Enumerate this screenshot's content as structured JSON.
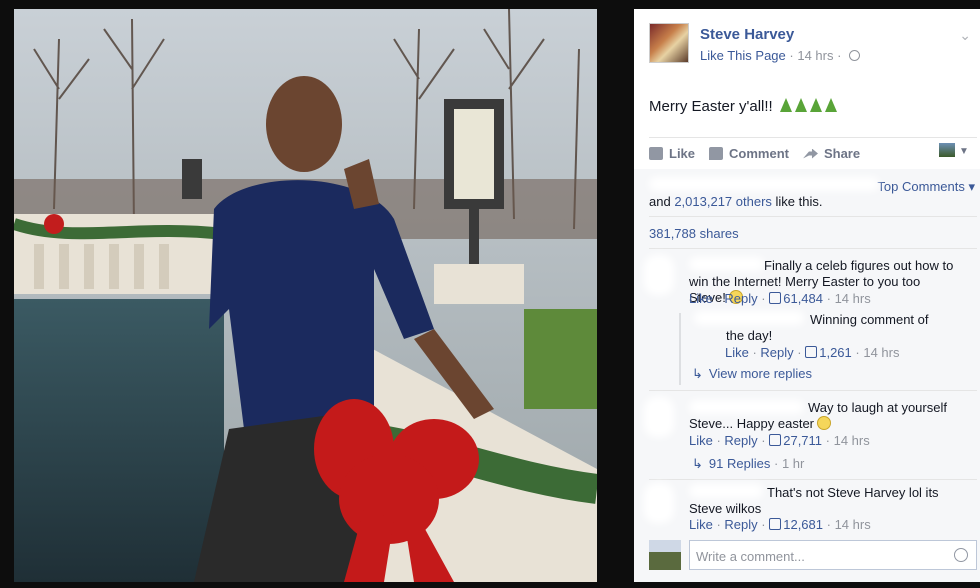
{
  "post": {
    "author": "Steve Harvey",
    "like_page": "Like This Page",
    "separator": "·",
    "time": "14 hrs",
    "text": "Merry Easter y'all!!",
    "emoji": [
      "christmas-tree",
      "christmas-tree",
      "christmas-tree",
      "christmas-tree"
    ]
  },
  "actions": {
    "like": "Like",
    "comment": "Comment",
    "share": "Share"
  },
  "summary": {
    "top_comments": "Top Comments",
    "likes_prefix": "and",
    "likes_count": "2,013,217 others",
    "likes_suffix": "like this.",
    "shares": "381,788 shares"
  },
  "comments": [
    {
      "text": "Finally a celeb figures out how to win the Internet! Merry Easter to you too Steve!",
      "like": "Like",
      "reply": "Reply",
      "likes": "61,484",
      "time": "14 hrs"
    },
    {
      "text": "Winning comment of the day!",
      "like": "Like",
      "reply": "Reply",
      "likes": "1,261",
      "time": "14 hrs"
    },
    {
      "text": "Way to laugh at yourself Steve... Happy easter",
      "like": "Like",
      "reply": "Reply",
      "likes": "27,711",
      "time": "14 hrs"
    },
    {
      "text": "That's not Steve Harvey lol its Steve wilkos",
      "like": "Like",
      "reply": "Reply",
      "likes": "12,681",
      "time": "14 hrs"
    }
  ],
  "replies": {
    "view_more": "View more replies",
    "count_label": "91 Replies",
    "count_time": "1 hr"
  },
  "composer": {
    "placeholder": "Write a comment..."
  },
  "colors": {
    "link": "#3b5998",
    "muted": "#90949c",
    "text": "#141823"
  }
}
